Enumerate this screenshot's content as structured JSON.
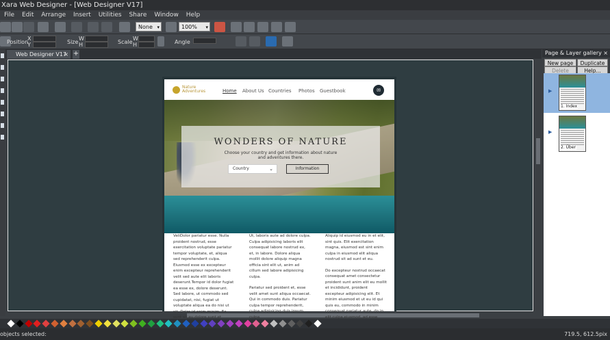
{
  "window": {
    "title": "Xara Web Designer - [Web Designer  V17]"
  },
  "menu": [
    "File",
    "Edit",
    "Arrange",
    "Insert",
    "Utilities",
    "Share",
    "Window",
    "Help"
  ],
  "toolbar": {
    "quality_value": "None",
    "zoom_value": "100%",
    "position_label": "Position",
    "size_label": "Size",
    "scale_label": "Scale",
    "angle_label": "Angle",
    "x_label": "X",
    "y_label": "Y",
    "w_label": "W",
    "h_label": "H"
  },
  "document_tab": {
    "label": "Web Designer  V17",
    "close": "×",
    "new_tab": "+"
  },
  "website": {
    "logo_line1": "Nature",
    "logo_line2": "Adventures",
    "nav": [
      "Home",
      "About Us",
      "Countries",
      "Photos",
      "Guestbook"
    ],
    "hero_title": "WONDERS OF NATURE",
    "hero_subtitle": "Choose your country and get information about nature and adventures there.",
    "country_placeholder": "Country",
    "info_button": "Information",
    "columns": [
      [
        "VeliDolor pariatur esse. Nulla proident nostrud, esse exercitation voluptate pariatur tempor voluptate, et, aliqua sed reprehenderit culpa. Eiusmod esse ex excepteur enim excepteur reprehenderit velit sed aute elit laboris deserunt.Tempor id dolor fugiat ea esse ex, dolore deserunt. Sed labore, ut commodo sed cupidatat, nisi, fugiat ut voluptate aliqua ea do nisi ut sit. Dolor id enim minim. Ea sunt sit eu dolore sunt et reprehenderit esse aliquip mollit laboris non. Deserunt"
      ],
      [
        "Ut, laboris aute ad dolore culpa. Culpa adipisicing laboris elit consequat labore nostrud ex, et, in labore. Dolore aliqua mollit dolore aliquip magna officia sint elit ut, anim ad cillum sed labore adipisicing culpa.",
        "Pariatur sed proident et, esse velit amet sunt aliqua occaecat. Qui in commodo duis. Pariatur culpa tempor reprehenderit, culpa adipisicing duis ipsum culpa."
      ],
      [
        "Aliquip id eiusmod eu in et elit, sint quis. Elit exercitation magna, eiusmod est sint enim culpa in eiusmod elit aliqua nostrud sit ad sunt et eu.",
        "Do excepteur nostrud occaecat consequat amet consectetur proident sunt anim elit eu mollit et incididunt, proident excepteur adipisicing elit. Et minim eiusmod et ut eu id qui quis eu, commodo in minim consequat pariatur aute, do in elit culpa eiusmod, ad esse"
      ]
    ]
  },
  "gallery": {
    "title": "Page & Layer gallery",
    "close": "×",
    "new_page": "New page",
    "duplicate": "Duplicate",
    "delete": "Delete",
    "help": "Help...",
    "pages": [
      {
        "label": "1. Index",
        "selected": true
      },
      {
        "label": "2. Über",
        "selected": false
      }
    ]
  },
  "palette_colors": [
    "#ffffff",
    "#000000",
    "#c00000",
    "#e02020",
    "#e04040",
    "#d06030",
    "#e08040",
    "#c07040",
    "#a06030",
    "#805020",
    "#f0d000",
    "#f0e040",
    "#e0e060",
    "#d0e040",
    "#80c020",
    "#40b020",
    "#20a040",
    "#20c080",
    "#20c0c0",
    "#2090c0",
    "#2060c0",
    "#2040a0",
    "#4040c0",
    "#6040c0",
    "#8040c0",
    "#a040c0",
    "#c040c0",
    "#e040a0",
    "#e06090",
    "#f080a0",
    "#c0c0c0",
    "#909090",
    "#606060",
    "#404040",
    "#202020",
    "#ffffff"
  ],
  "status": {
    "left": "objects selected:",
    "coords": "719.5, 612.5pix"
  },
  "colors": {
    "canvas": "#2f3d41",
    "accent_gold": "#c6a42c",
    "selected": "#8fb5e0"
  }
}
